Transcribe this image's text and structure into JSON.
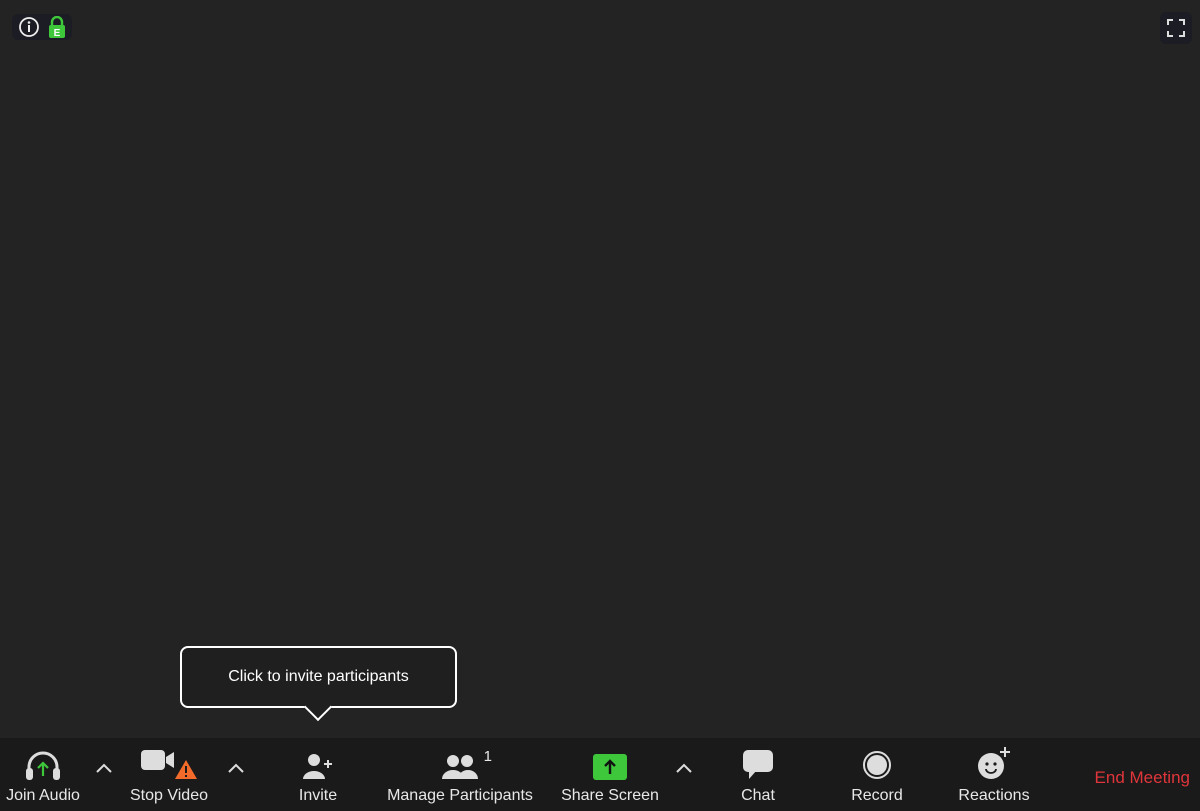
{
  "top": {
    "info_icon": "info-icon",
    "encryption_icon": "lock-icon",
    "encryption_letter": "E",
    "fullscreen_icon": "fullscreen-icon"
  },
  "tooltip": {
    "text": "Click to invite participants"
  },
  "toolbar": {
    "join_audio": "Join Audio",
    "stop_video": "Stop Video",
    "invite": "Invite",
    "manage_participants": "Manage Participants",
    "participant_count": "1",
    "share_screen": "Share Screen",
    "chat": "Chat",
    "record": "Record",
    "reactions": "Reactions",
    "end_meeting": "End Meeting"
  },
  "colors": {
    "accent_green": "#3ec73b",
    "warning": "#f26b2a",
    "end": "#e0353a"
  }
}
